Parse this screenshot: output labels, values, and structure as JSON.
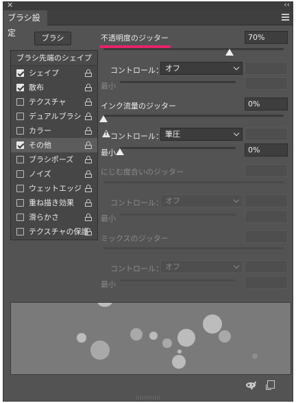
{
  "titlebar": {
    "close_icon": "close-icon",
    "collapse_icon": "double-chevron-icon"
  },
  "tab": {
    "label": "ブラシ設定",
    "menu_icon": "panel-menu-icon"
  },
  "brush_button": "ブラシ",
  "list": {
    "header": "ブラシ先端のシェイプ",
    "items": [
      {
        "label": "シェイプ",
        "checked": true,
        "selected": false
      },
      {
        "label": "散布",
        "checked": true,
        "selected": false
      },
      {
        "label": "テクスチャ",
        "checked": false,
        "selected": false
      },
      {
        "label": "デュアルブラシ",
        "checked": false,
        "selected": false
      },
      {
        "label": "カラー",
        "checked": false,
        "selected": false
      },
      {
        "label": "その他",
        "checked": true,
        "selected": true
      },
      {
        "label": "ブラシポーズ",
        "checked": false,
        "selected": false
      },
      {
        "label": "ノイズ",
        "checked": false,
        "selected": false
      },
      {
        "label": "ウェットエッジ",
        "checked": false,
        "selected": false
      },
      {
        "label": "重ね描き効果",
        "checked": false,
        "selected": false
      },
      {
        "label": "滑らかさ",
        "checked": false,
        "selected": false
      },
      {
        "label": "テクスチャの保護",
        "checked": false,
        "selected": false
      }
    ]
  },
  "opacity": {
    "label": "不透明度のジッター",
    "value": "70%",
    "slider_percent": 70,
    "control_label": "コントロール：",
    "control_value": "オフ",
    "min_label": "最小",
    "min_value": ""
  },
  "flow": {
    "label": "インク流量のジッター",
    "value": "0%",
    "slider_percent": 0,
    "control_label": "コントロール：",
    "control_value": "筆圧",
    "min_label": "最小",
    "min_value": "0%",
    "min_slider_percent": 0,
    "warning_icon": "warning-icon"
  },
  "wet": {
    "label": "にじむ度合いのジッター",
    "control_label": "コントロール：",
    "control_value": "オフ",
    "min_label": "最小"
  },
  "mix": {
    "label": "ミックスのジッター",
    "control_label": "コントロール：",
    "control_value": "オフ",
    "min_label": "最小"
  },
  "footer": {
    "toggle_icon": "eye-slash-icon",
    "new_icon": "new-preset-icon"
  },
  "colors": {
    "panel": "#535353",
    "accent": "#e8226c",
    "field": "#3e3e3e"
  }
}
